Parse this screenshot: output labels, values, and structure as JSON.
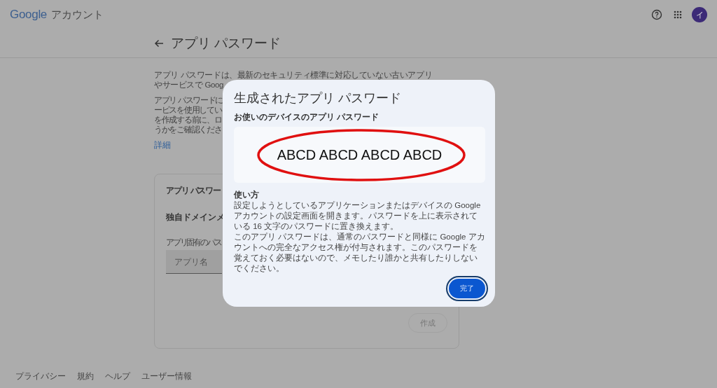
{
  "header": {
    "logo": "Google",
    "product": "アカウント",
    "avatar": "イ"
  },
  "page": {
    "title": "アプリ パスワード",
    "paragraphs": [
      [
        "アプリ パスワードは、最新のセキュリティ標準に対応していない古いアプリ",
        "やサービスで Goog"
      ],
      [
        "アプリ パスワードに",
        "ービスを使用してい",
        "を作成する前に、ロ",
        "うかをご確認くださ"
      ]
    ],
    "link": "詳細",
    "card": {
      "title": "アプリ パスワー",
      "subtitle": "独自ドメインメ",
      "field_label": "アプリ固有のパス",
      "field": {
        "placeholder": "アプリ名"
      },
      "button": {
        "label": "作成",
        "disabled": true
      }
    }
  },
  "footer": [
    "プライバシー",
    "規約",
    "ヘルプ",
    "ユーザー情報"
  ],
  "dialog": {
    "title": "生成されたアプリ パスワード",
    "password_label": "お使いのデバイスのアプリ パスワード",
    "password": "ABCD ABCD ABCD ABCD",
    "usage_heading": "使い方",
    "usage": [
      "設定しようとしているアプリケーションまたはデバイスの Google アカウントの設定画面を開きます。パスワードを上に表示されている 16 文字のパスワードに置き換えます。",
      "このアプリ パスワードは、通常のパスワードと同様に Google アカウントへの完全なアクセス権が付与されます。このパスワードを覚えておく必要はないので、メモしたり誰かと共有したりしないでください。"
    ],
    "button": {
      "label": "完了",
      "focused": true
    }
  }
}
